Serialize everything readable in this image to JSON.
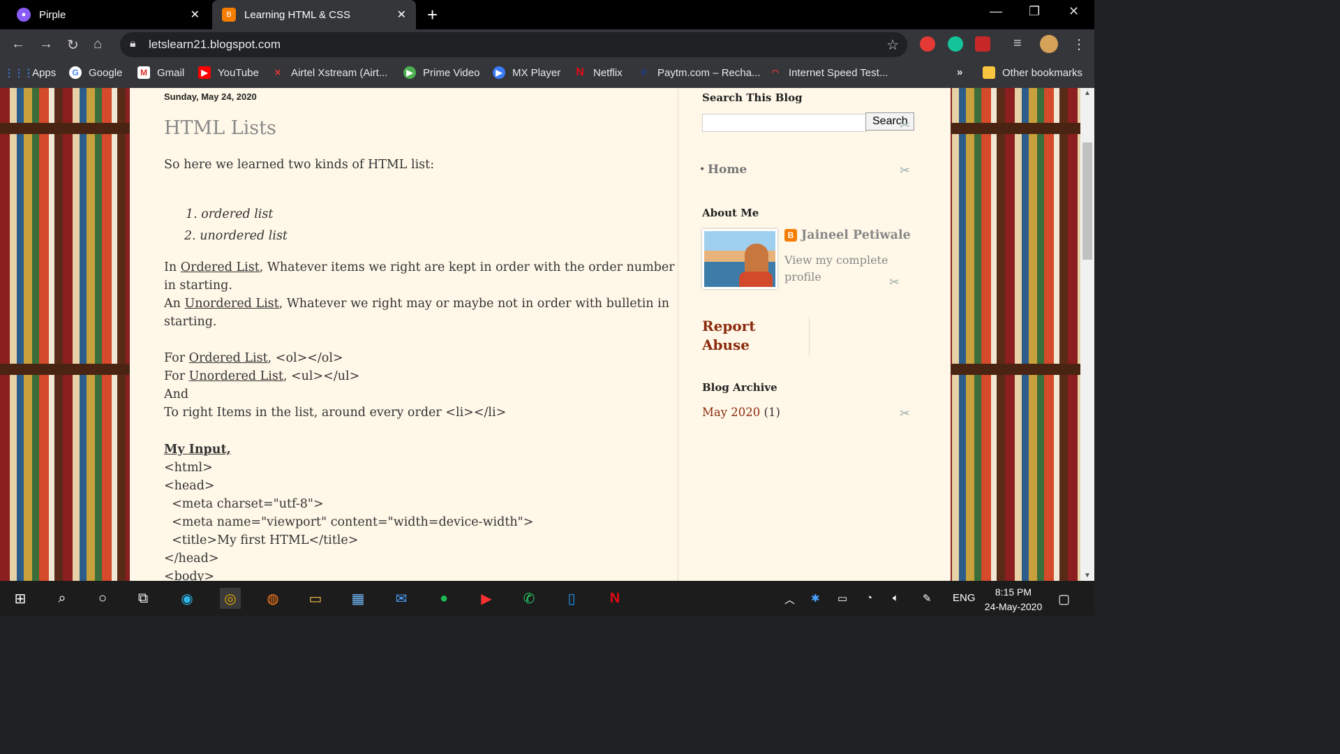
{
  "browser": {
    "tabs": [
      {
        "title": "Pirple",
        "active": false
      },
      {
        "title": "Learning HTML & CSS",
        "active": true
      }
    ],
    "url": "letslearn21.blogspot.com",
    "new_tab_glyph": "+",
    "window_controls": {
      "minimize": "—",
      "restore": "❐",
      "close": "✕"
    }
  },
  "bookmarks": {
    "items": [
      {
        "label": "Apps",
        "icon": "apps-icon"
      },
      {
        "label": "Google",
        "icon": "google-icon"
      },
      {
        "label": "Gmail",
        "icon": "gmail-icon"
      },
      {
        "label": "YouTube",
        "icon": "youtube-icon"
      },
      {
        "label": "Airtel Xstream (Airt...",
        "icon": "airtel-icon"
      },
      {
        "label": "Prime Video",
        "icon": "prime-video-icon"
      },
      {
        "label": "MX Player",
        "icon": "mx-player-icon"
      },
      {
        "label": "Netflix",
        "icon": "netflix-icon"
      },
      {
        "label": "Paytm.com – Recha...",
        "icon": "paytm-icon"
      },
      {
        "label": "Internet Speed Test...",
        "icon": "speedtest-icon"
      }
    ],
    "overflow": "»",
    "other": "Other bookmarks"
  },
  "post": {
    "date": "Sunday, May 24, 2020",
    "title": "HTML Lists",
    "intro": "So here we learned two kinds of HTML list:",
    "list": [
      "1. ordered list",
      "2. unordered list"
    ],
    "p1a_pre": "In ",
    "p1a_link": "Ordered List",
    "p1a_post": ", Whatever items we right are kept in order with the order number",
    "p1b": "in starting.",
    "p2a_pre": "An ",
    "p2a_link": "Unordered List",
    "p2a_post": ", Whatever we right may or maybe not in order with bulletin in",
    "p2b": "starting.",
    "for1_pre": "For ",
    "for1_link": "Ordered List",
    "for1_post": ", <ol></ol>",
    "for2_pre": "For ",
    "for2_link": "Unordered List",
    "for2_post": ", <ul></ul>",
    "and": "And",
    "right_items": "To right Items in the list, around every order <li></li>",
    "my_input": "My Input,",
    "code": [
      "<html>",
      "<head>",
      "  <meta charset=\"utf-8\">",
      "  <meta name=\"viewport\" content=\"width=device-width\">",
      "  <title>My first HTML</title>",
      "</head>",
      "<body>"
    ]
  },
  "sidebar": {
    "search_title": "Search This Blog",
    "search_button": "Search",
    "search_value": "",
    "home": "Home",
    "about_title": "About Me",
    "author": "Jaineel Petiwale",
    "view_profile": "View my complete profile",
    "report_abuse": "Report Abuse",
    "archive_title": "Blog Archive",
    "archive_month": "May 2020",
    "archive_count": "(1)"
  },
  "taskbar": {
    "language": "ENG",
    "time": "8:15 PM",
    "date": "24-May-2020"
  },
  "colors": {
    "page_bg": "#fff8e8",
    "link_accent": "#8b2b0e",
    "chrome_dark": "#35363a"
  }
}
